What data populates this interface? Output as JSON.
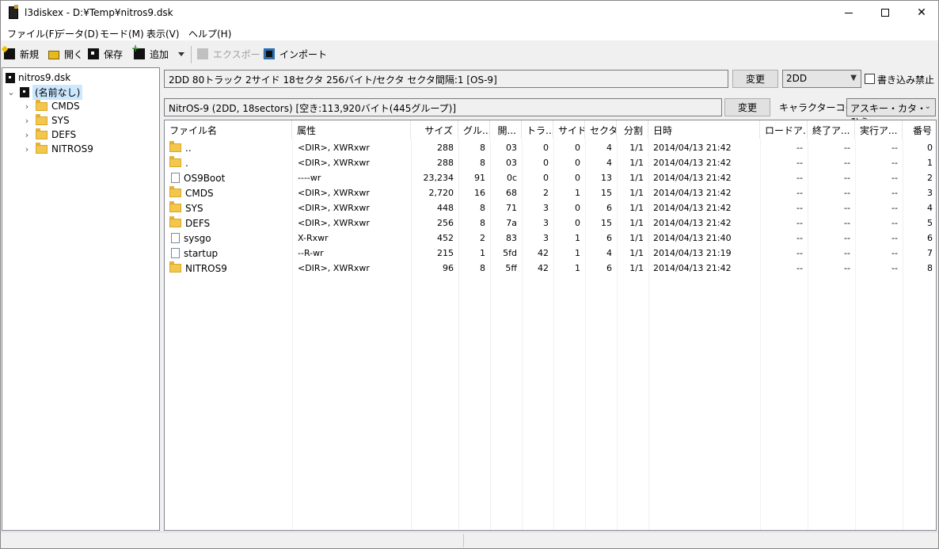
{
  "window": {
    "title": "l3diskex - D:¥Temp¥nitros9.dsk",
    "icon": "app-icon"
  },
  "menu": [
    "ファイル(F)",
    "データ(D)",
    "モード(M)",
    "表示(V)",
    "ヘルプ(H)"
  ],
  "toolbar": {
    "new": "新規",
    "open": "開く",
    "save": "保存",
    "add": "追加",
    "export": "エクスポート",
    "import": "インポート"
  },
  "tree": {
    "disk": "nitros9.dsk",
    "root": "(名前なし)",
    "folders": [
      "CMDS",
      "SYS",
      "DEFS",
      "NITROS9"
    ]
  },
  "disk_info": {
    "text": "2DD  80トラック 2サイド 18セクタ 256バイト/セクタ セクタ間隔:1 [OS-9]",
    "change_label": "変更",
    "type_value": "2DD",
    "write_protect_label": "書き込み禁止",
    "write_protect_checked": false
  },
  "fs_info": {
    "text": "NitrOS-9 (2DD, 18sectors) [空き:113,920バイト(445グループ)]",
    "change_label": "変更",
    "charcode_label": "キャラクターコード",
    "charcode_value": "アスキー・カタ・ひら"
  },
  "columns": [
    "ファイル名",
    "属性",
    "サイズ",
    "グル...",
    "開...",
    "トラ...",
    "サイド",
    "セクタ",
    "分割",
    "日時",
    "ロードア...",
    "終了ア...",
    "実行ア...",
    "番号"
  ],
  "files": [
    {
      "type": "folder",
      "name": "..",
      "attr": "<DIR>, XWRxwr",
      "size": "288",
      "group": "8",
      "start": "03",
      "track": "0",
      "side": "0",
      "sector": "4",
      "div": "1/1",
      "date": "2014/04/13 21:42",
      "load": "--",
      "end": "--",
      "exec": "--",
      "num": "0"
    },
    {
      "type": "folder",
      "name": ".",
      "attr": "<DIR>, XWRxwr",
      "size": "288",
      "group": "8",
      "start": "03",
      "track": "0",
      "side": "0",
      "sector": "4",
      "div": "1/1",
      "date": "2014/04/13 21:42",
      "load": "--",
      "end": "--",
      "exec": "--",
      "num": "1"
    },
    {
      "type": "file",
      "name": "OS9Boot",
      "attr": "----wr",
      "size": "23,234",
      "group": "91",
      "start": "0c",
      "track": "0",
      "side": "0",
      "sector": "13",
      "div": "1/1",
      "date": "2014/04/13 21:42",
      "load": "--",
      "end": "--",
      "exec": "--",
      "num": "2"
    },
    {
      "type": "folder",
      "name": "CMDS",
      "attr": "<DIR>, XWRxwr",
      "size": "2,720",
      "group": "16",
      "start": "68",
      "track": "2",
      "side": "1",
      "sector": "15",
      "div": "1/1",
      "date": "2014/04/13 21:42",
      "load": "--",
      "end": "--",
      "exec": "--",
      "num": "3"
    },
    {
      "type": "folder",
      "name": "SYS",
      "attr": "<DIR>, XWRxwr",
      "size": "448",
      "group": "8",
      "start": "71",
      "track": "3",
      "side": "0",
      "sector": "6",
      "div": "1/1",
      "date": "2014/04/13 21:42",
      "load": "--",
      "end": "--",
      "exec": "--",
      "num": "4"
    },
    {
      "type": "folder",
      "name": "DEFS",
      "attr": "<DIR>, XWRxwr",
      "size": "256",
      "group": "8",
      "start": "7a",
      "track": "3",
      "side": "0",
      "sector": "15",
      "div": "1/1",
      "date": "2014/04/13 21:42",
      "load": "--",
      "end": "--",
      "exec": "--",
      "num": "5"
    },
    {
      "type": "file",
      "name": "sysgo",
      "attr": "X-Rxwr",
      "size": "452",
      "group": "2",
      "start": "83",
      "track": "3",
      "side": "1",
      "sector": "6",
      "div": "1/1",
      "date": "2014/04/13 21:40",
      "load": "--",
      "end": "--",
      "exec": "--",
      "num": "6"
    },
    {
      "type": "file",
      "name": "startup",
      "attr": "--R-wr",
      "size": "215",
      "group": "1",
      "start": "5fd",
      "track": "42",
      "side": "1",
      "sector": "4",
      "div": "1/1",
      "date": "2014/04/13 21:19",
      "load": "--",
      "end": "--",
      "exec": "--",
      "num": "7"
    },
    {
      "type": "folder",
      "name": "NITROS9",
      "attr": "<DIR>, XWRxwr",
      "size": "96",
      "group": "8",
      "start": "5ff",
      "track": "42",
      "side": "1",
      "sector": "6",
      "div": "1/1",
      "date": "2014/04/13 21:42",
      "load": "--",
      "end": "--",
      "exec": "--",
      "num": "8"
    }
  ]
}
